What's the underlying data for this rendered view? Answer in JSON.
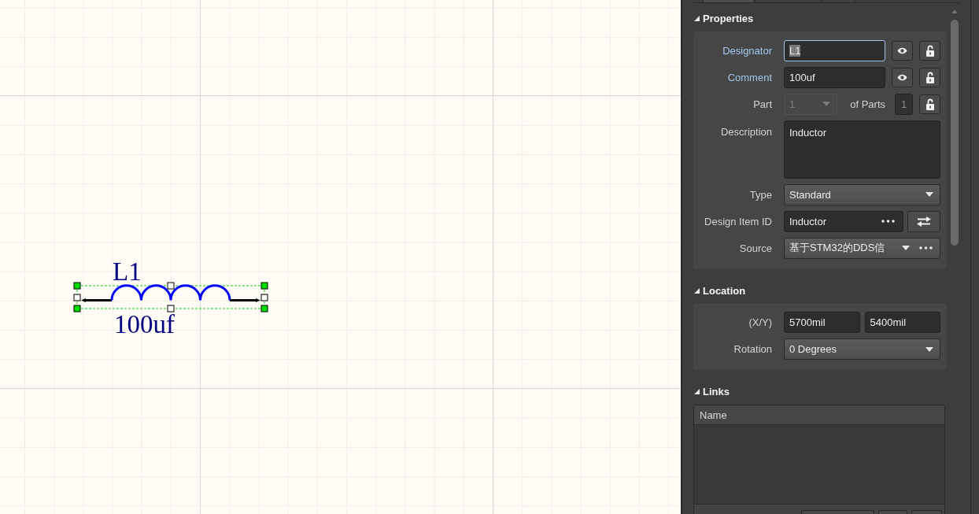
{
  "canvas": {
    "component": {
      "designator": "L1",
      "comment": "100uf",
      "selected": true
    }
  },
  "panel": {
    "tabs": [
      {
        "selected": true
      },
      {
        "selected": false
      },
      {
        "selected": false
      }
    ],
    "sections": [
      {
        "kind": "form",
        "title": "Properties",
        "expanded": true,
        "rows": [
          {
            "kind": "text",
            "label": "Designator",
            "highlighted": true,
            "value": "L1",
            "focused": true,
            "text_selected": true,
            "visible": true,
            "locked": false
          },
          {
            "kind": "text",
            "label": "Comment",
            "highlighted": true,
            "value": "100uf",
            "focused": false,
            "text_selected": false,
            "visible": true,
            "locked": false
          },
          {
            "kind": "part",
            "label": "Part",
            "highlighted": false,
            "value": "1",
            "disabled": true,
            "parts_label": "of Parts",
            "parts_count": "1",
            "locked": false
          },
          {
            "kind": "multiline",
            "label": "Description",
            "highlighted": false,
            "value": "Inductor"
          },
          {
            "kind": "dropdown",
            "label": "Type",
            "highlighted": false,
            "value": "Standard"
          },
          {
            "kind": "item-id",
            "label": "Design Item ID",
            "highlighted": false,
            "value": "Inductor"
          },
          {
            "kind": "dropdown-more",
            "label": "Source",
            "highlighted": false,
            "value": "基于STM32的DDS信"
          }
        ]
      },
      {
        "kind": "form",
        "title": "Location",
        "expanded": true,
        "rows": [
          {
            "kind": "pair",
            "label": "(X/Y)",
            "highlighted": false,
            "values": [
              "5700mil",
              "5400mil"
            ]
          },
          {
            "kind": "dropdown",
            "label": "Rotation",
            "highlighted": false,
            "value": "0 Degrees"
          }
        ]
      },
      {
        "kind": "table",
        "title": "Links",
        "expanded": true,
        "columns": [
          "Name"
        ]
      }
    ]
  }
}
